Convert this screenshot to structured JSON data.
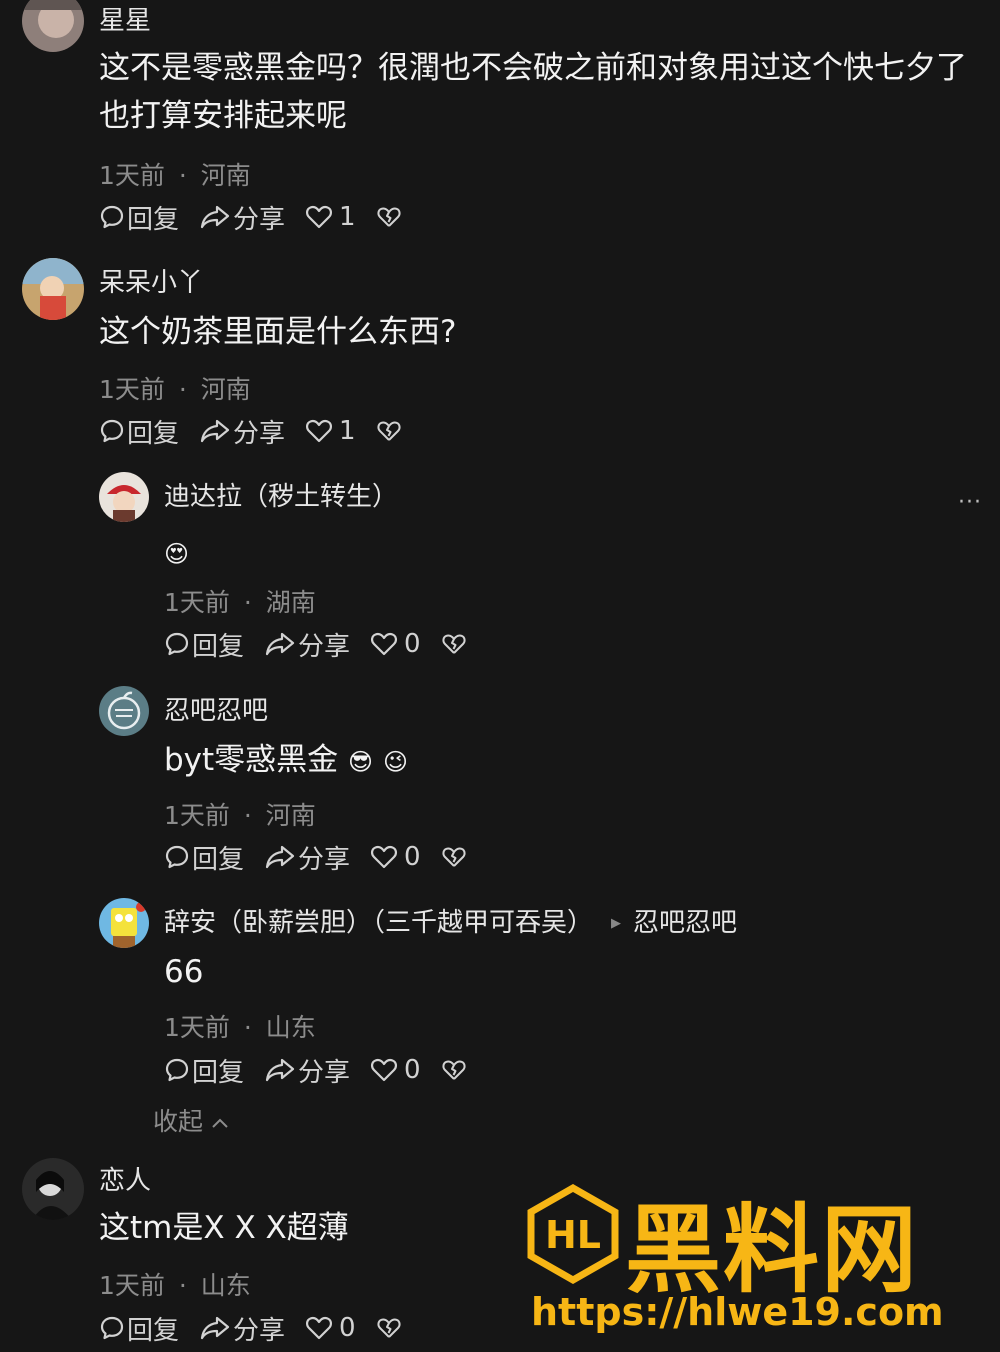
{
  "colors": {
    "background": "#161616",
    "text": "#f2f2f2",
    "meta": "#8c8c8c",
    "watermark": "#f7b615"
  },
  "comments": [
    {
      "username": "星星",
      "text": "这不是零惑黑金吗？很潤也不会破之前和对象用过这个快七夕了也打算安排起来呢",
      "time": "1天前",
      "location": "河南",
      "reply_label": "回复",
      "share_label": "分享",
      "likes": "1"
    },
    {
      "username": "呆呆小丫",
      "text": "这个奶茶里面是什么东西?",
      "time": "1天前",
      "location": "河南",
      "reply_label": "回复",
      "share_label": "分享",
      "likes": "1"
    },
    {
      "username": "恋人",
      "text": "这tm是X X X超薄",
      "time": "1天前",
      "location": "山东",
      "reply_label": "回复",
      "share_label": "分享",
      "likes": "0"
    }
  ],
  "replies": [
    {
      "username": "迪达拉（秽土转生）",
      "text": "",
      "emojis": [
        "😍"
      ],
      "time": "1天前",
      "location": "湖南",
      "reply_label": "回复",
      "share_label": "分享",
      "likes": "0"
    },
    {
      "username": "忍吧忍吧",
      "text": "byt零惑黑金",
      "emojis": [
        "😎",
        "😉"
      ],
      "time": "1天前",
      "location": "河南",
      "reply_label": "回复",
      "share_label": "分享",
      "likes": "0"
    },
    {
      "username": "辞安（卧薪尝胆）（三千越甲可吞吴）",
      "reply_to": "忍吧忍吧",
      "text": "66",
      "time": "1天前",
      "location": "山东",
      "reply_label": "回复",
      "share_label": "分享",
      "likes": "0"
    }
  ],
  "more_label": "···",
  "collapse_label": "收起",
  "meta_separator": "·",
  "watermark": {
    "title": "黑料网",
    "logo_text": "HL",
    "url": "https://hlwe19.com"
  }
}
